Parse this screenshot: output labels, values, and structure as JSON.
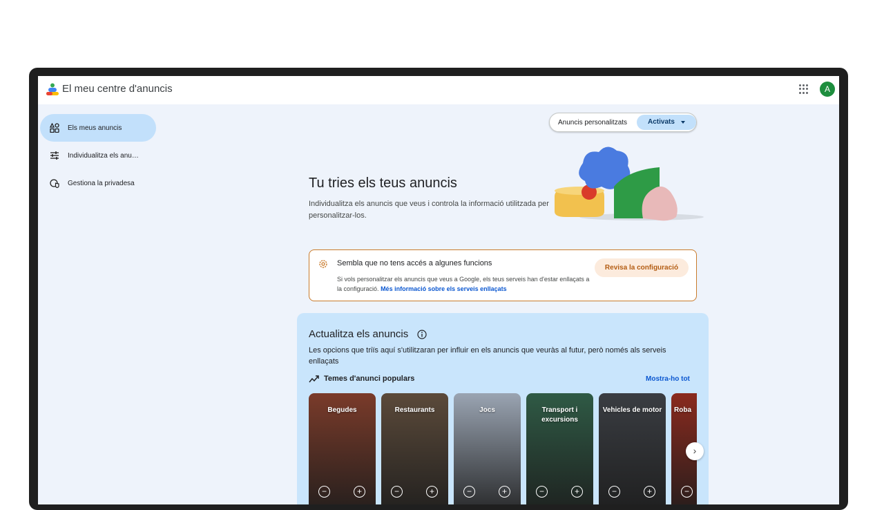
{
  "app": {
    "title": "El meu centre d'anuncis",
    "avatar_letter": "A"
  },
  "sidebar": {
    "items": [
      {
        "label": "Els meus anuncis",
        "icon": "shapes-icon",
        "active": true
      },
      {
        "label": "Individualitza els anu…",
        "icon": "tune-sliders-icon",
        "active": false
      },
      {
        "label": "Gestiona la privadesa",
        "icon": "privacy-shield-icon",
        "active": false
      }
    ]
  },
  "personalized_ads": {
    "label": "Anuncis personalitzats",
    "value": "Activats"
  },
  "hero": {
    "title": "Tu tries els teus anuncis",
    "text": "Individualitza els anuncis que veus i controla la informació utilitzada per personalitzar-los."
  },
  "notice": {
    "title": "Sembla que no tens accés a algunes funcions",
    "text": "Si vols personalitzar els anuncis que veus a Google, els teus serveis han d'estar enllaçats a la configuració.",
    "link": "Més informació sobre els serveis enllaçats",
    "button": "Revisa la configuració",
    "accent_color": "#c97a2a"
  },
  "update": {
    "title": "Actualitza els anuncis",
    "text": "Les opcions que triïs aquí s'utilitzaran per influir en els anuncis que veuràs al futur, però només als serveis enllaçats",
    "topics_label": "Temes d'anunci populars",
    "show_all": "Mostra-ho tot"
  },
  "topics": [
    {
      "label": "Begudes",
      "color": "#7a3b2a"
    },
    {
      "label": "Restaurants",
      "color": "#5b4a3a"
    },
    {
      "label": "Jocs",
      "color": "#9aa4b2"
    },
    {
      "label": "Transport i excursions",
      "color": "#2f5a45"
    },
    {
      "label": "Vehicles de motor",
      "color": "#3a3d42"
    },
    {
      "label": "Roba",
      "color": "#8a2a1e"
    }
  ],
  "card_controls": {
    "minus": "−",
    "plus": "+"
  }
}
